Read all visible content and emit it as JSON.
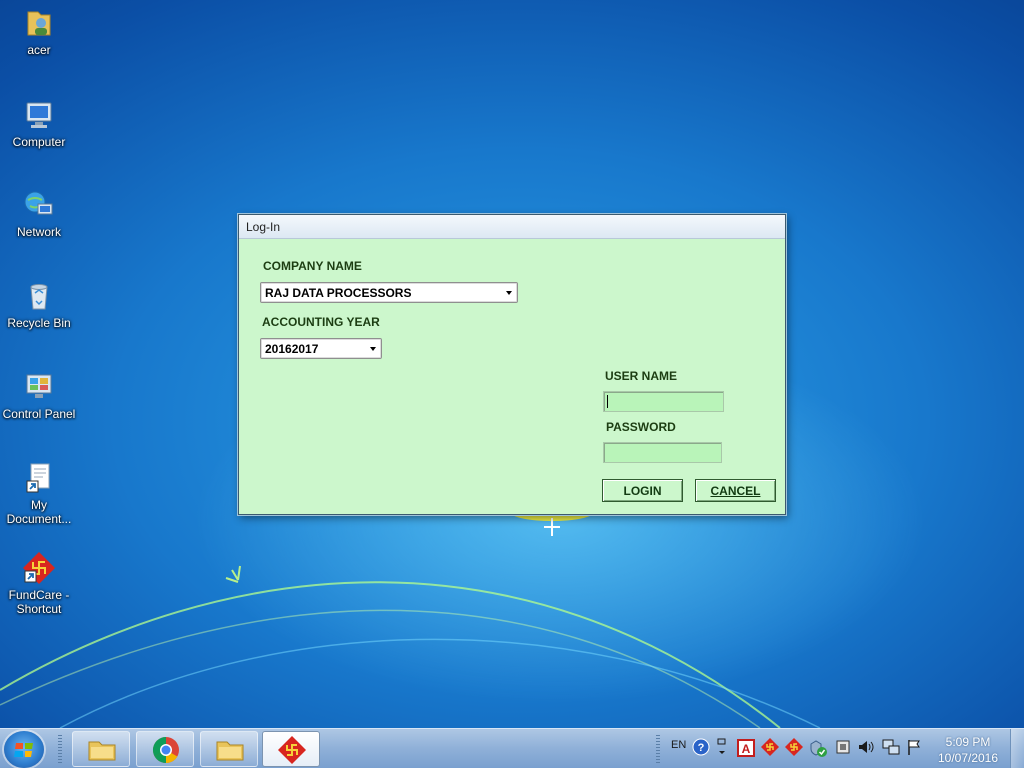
{
  "desktop": {
    "icons": [
      {
        "label": "acer"
      },
      {
        "label": "Computer"
      },
      {
        "label": "Network"
      },
      {
        "label": "Recycle Bin"
      },
      {
        "label": "Control Panel"
      },
      {
        "label": "My Document..."
      },
      {
        "label": "FundCare - Shortcut"
      }
    ]
  },
  "dialog": {
    "title": "Log-In",
    "company_label": "COMPANY NAME",
    "company_value": "RAJ DATA PROCESSORS",
    "year_label": "ACCOUNTING YEAR",
    "year_value": "20162017",
    "username_label": "USER NAME",
    "username_value": "",
    "password_label": "PASSWORD",
    "password_value": "",
    "login_label": "LOGIN",
    "cancel_label": "CANCEL",
    "field_color": "#ccf7cc"
  },
  "taskbar": {
    "language": "EN",
    "time": "5:09 PM",
    "date": "10/07/2016",
    "pinned": [
      "folder-icon",
      "chrome-icon",
      "folder-icon",
      "fundcare-icon"
    ]
  }
}
